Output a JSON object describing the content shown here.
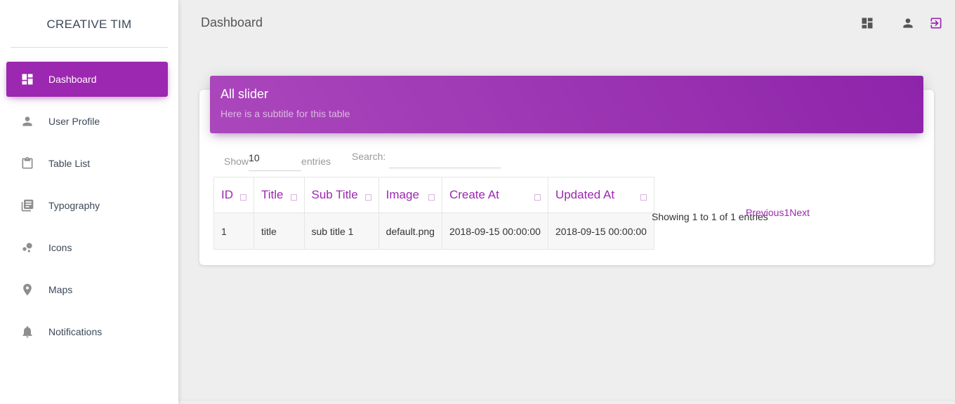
{
  "brand": "CREATIVE TIM",
  "sidebar": {
    "items": [
      {
        "label": "Dashboard",
        "icon": "dashboard-icon",
        "active": true
      },
      {
        "label": "User Profile",
        "icon": "person-icon"
      },
      {
        "label": "Table List",
        "icon": "clipboard-icon"
      },
      {
        "label": "Typography",
        "icon": "library-books-icon"
      },
      {
        "label": "Icons",
        "icon": "bubble-chart-icon"
      },
      {
        "label": "Maps",
        "icon": "location-pin-icon"
      },
      {
        "label": "Notifications",
        "icon": "bell-icon"
      }
    ]
  },
  "topbar": {
    "title": "Dashboard",
    "icons": [
      "dashboard-icon",
      "person-icon",
      "logout-icon"
    ]
  },
  "card": {
    "title": "All slider",
    "subtitle": "Here is a subtitle for this table"
  },
  "table_controls": {
    "show_label": "Show",
    "length_value": "10",
    "entries_label": "entries",
    "search_label": "Search:",
    "search_value": ""
  },
  "table": {
    "headers": [
      "ID",
      "Title",
      "Sub Title",
      "Image",
      "Create At",
      "Updated At"
    ],
    "rows": [
      [
        "1",
        "title",
        "sub title 1",
        "default.png",
        "2018-09-15 00:00:00",
        "2018-09-15 00:00:00"
      ]
    ]
  },
  "pagination": {
    "info": "Showing 1 to 1 of 1 entries",
    "previous": "Previous",
    "page": "1",
    "next": "Next"
  },
  "colors": {
    "accent": "#9c27b0",
    "header_gradient_start": "#ab47bc",
    "header_gradient_end": "#8e24aa",
    "background": "#eeeeee"
  }
}
